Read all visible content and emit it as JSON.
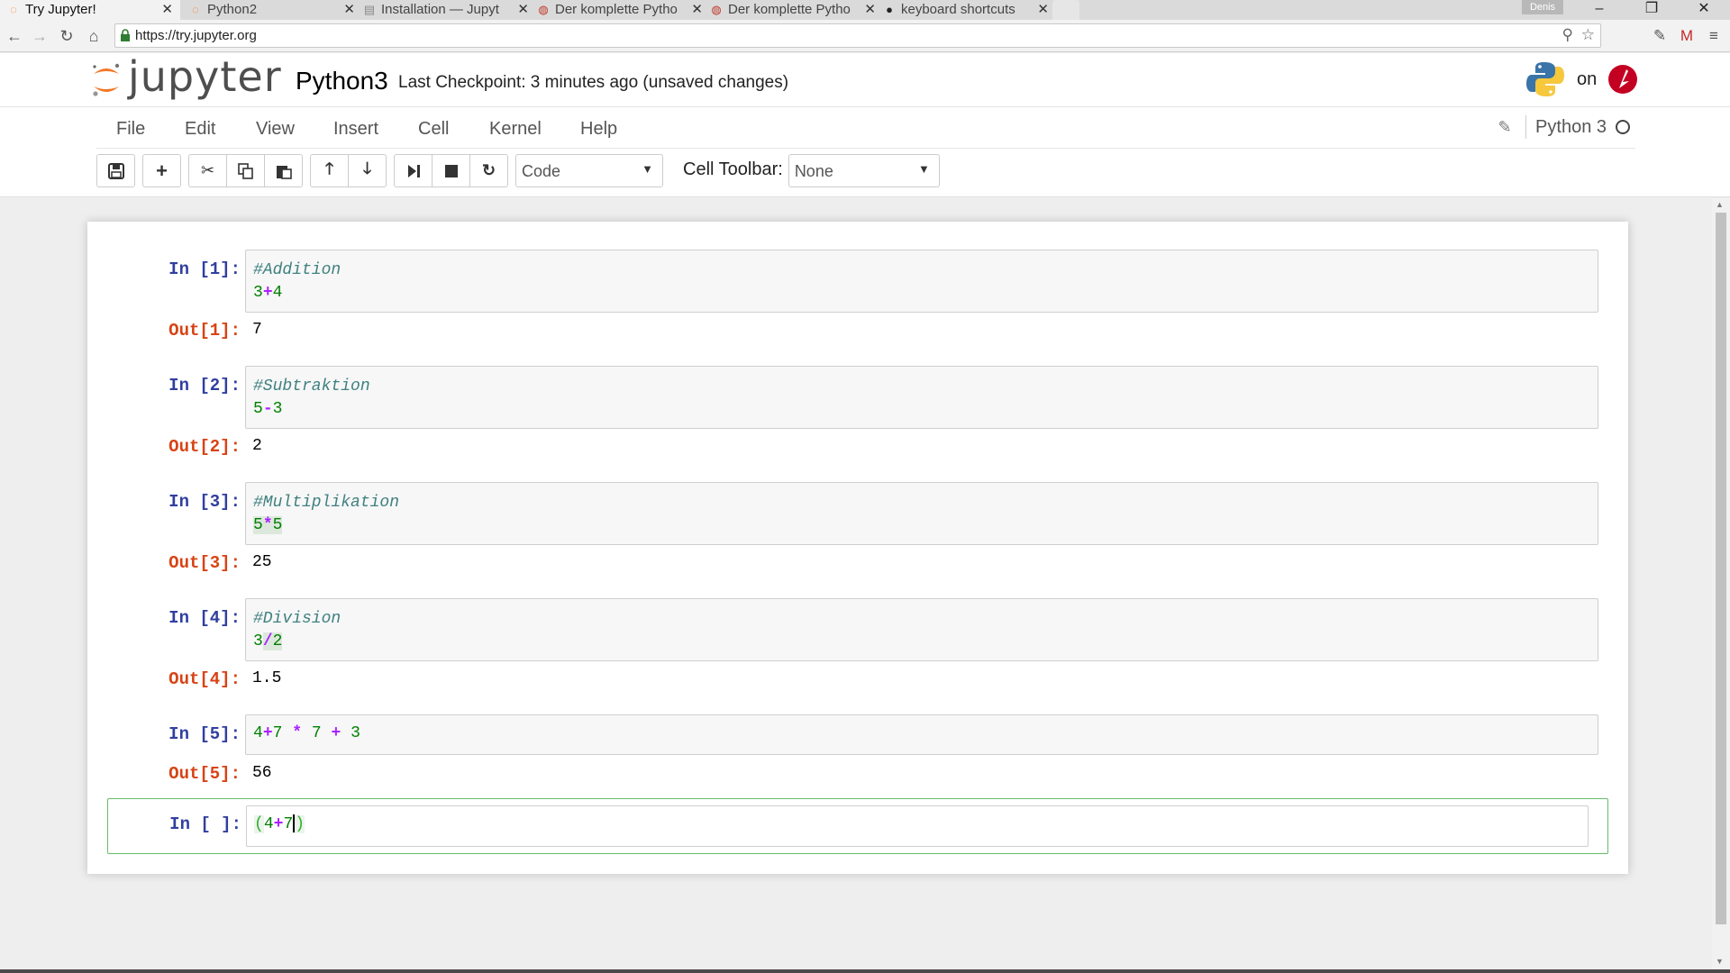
{
  "browser": {
    "tabs": [
      {
        "title": "Try Jupyter!",
        "icon": "jupyter-icon",
        "active": true
      },
      {
        "title": "Python2",
        "icon": "jupyter-icon",
        "active": false
      },
      {
        "title": "Installation — Jupyt",
        "icon": "doc-icon",
        "active": false
      },
      {
        "title": "Der komplette Pytho",
        "icon": "udemy-icon",
        "active": false
      },
      {
        "title": "Der komplette Pytho",
        "icon": "udemy-icon",
        "active": false
      },
      {
        "title": "keyboard shortcuts",
        "icon": "github-icon",
        "active": false
      }
    ],
    "profile_name": "Denis",
    "url": "https://try.jupyter.org",
    "window_controls": {
      "minimize": "–",
      "restore": "❐",
      "close": "✕"
    }
  },
  "jupyter": {
    "logo_text": "jupyter",
    "notebook_name": "Python3",
    "checkpoint": "Last Checkpoint: 3 minutes ago (unsaved changes)",
    "on_text": "on",
    "menu": [
      "File",
      "Edit",
      "View",
      "Insert",
      "Cell",
      "Kernel",
      "Help"
    ],
    "kernel_name": "Python 3",
    "cell_type": "Code",
    "cell_toolbar_label": "Cell Toolbar:",
    "cell_toolbar_value": "None"
  },
  "cells": [
    {
      "in_prompt": "In [1]:",
      "comment": "#Addition",
      "code": [
        [
          "num",
          "3"
        ],
        [
          "op",
          "+"
        ],
        [
          "num",
          "4"
        ]
      ],
      "out_prompt": "Out[1]:",
      "output": "7"
    },
    {
      "in_prompt": "In [2]:",
      "comment": "#Subtraktion",
      "code": [
        [
          "num",
          "5"
        ],
        [
          "op",
          "-"
        ],
        [
          "num",
          "3"
        ]
      ],
      "out_prompt": "Out[2]:",
      "output": "2"
    },
    {
      "in_prompt": "In [3]:",
      "comment": "#Multiplikation",
      "code": [
        [
          "num",
          "5"
        ],
        [
          "op",
          "*"
        ],
        [
          "num",
          "5"
        ]
      ],
      "out_prompt": "Out[3]:",
      "output": "25"
    },
    {
      "in_prompt": "In [4]:",
      "comment": "#Division",
      "code": [
        [
          "num",
          "3"
        ],
        [
          "op",
          "/"
        ],
        [
          "num",
          "2"
        ]
      ],
      "out_prompt": "Out[4]:",
      "output": "1.5"
    },
    {
      "in_prompt": "In [5]:",
      "comment": "",
      "code": [
        [
          "num",
          "4"
        ],
        [
          "op",
          "+"
        ],
        [
          "num",
          "7 "
        ],
        [
          "op",
          "*"
        ],
        [
          "num",
          " 7 "
        ],
        [
          "op",
          "+"
        ],
        [
          "num",
          " 3"
        ]
      ],
      "out_prompt": "Out[5]:",
      "output": "56"
    }
  ],
  "active_cell": {
    "in_prompt": "In [ ]:",
    "open_paren": "(",
    "code_a": "4",
    "code_op": "+",
    "code_b": "7",
    "close_paren": ")"
  }
}
